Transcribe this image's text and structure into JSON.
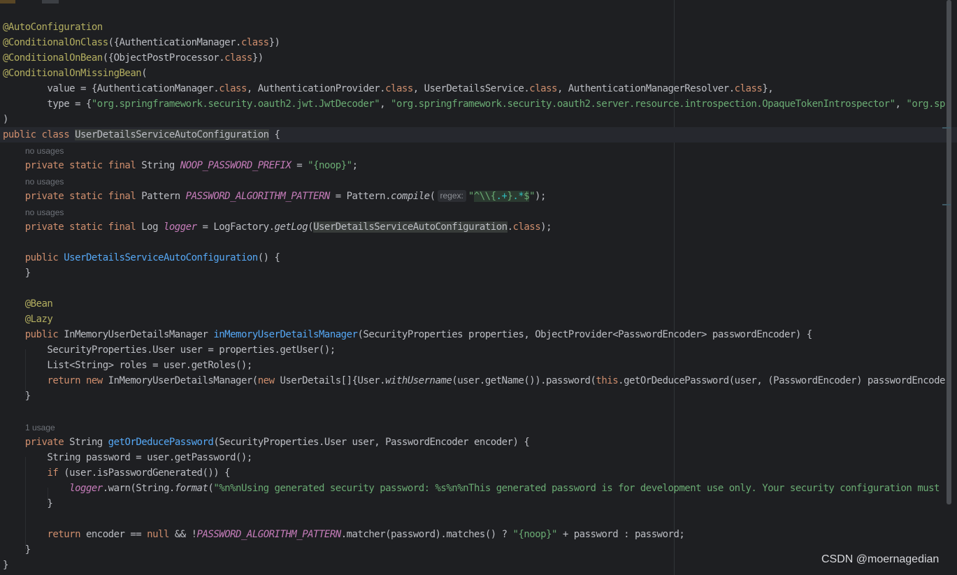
{
  "code_lines": [
    [
      {
        "t": "@AutoConfiguration",
        "c": "ann"
      }
    ],
    [
      {
        "t": "@ConditionalOnClass",
        "c": "ann"
      },
      {
        "t": "({AuthenticationManager."
      },
      {
        "t": "class",
        "c": "kw"
      },
      {
        "t": "})"
      }
    ],
    [
      {
        "t": "@ConditionalOnBean",
        "c": "ann"
      },
      {
        "t": "({ObjectPostProcessor."
      },
      {
        "t": "class",
        "c": "kw"
      },
      {
        "t": "})"
      }
    ],
    [
      {
        "t": "@ConditionalOnMissingBean",
        "c": "ann"
      },
      {
        "t": "("
      }
    ],
    [
      {
        "t": "        value = {AuthenticationManager."
      },
      {
        "t": "class",
        "c": "kw"
      },
      {
        "t": ", AuthenticationProvider."
      },
      {
        "t": "class",
        "c": "kw"
      },
      {
        "t": ", UserDetailsService."
      },
      {
        "t": "class",
        "c": "kw"
      },
      {
        "t": ", AuthenticationManagerResolver."
      },
      {
        "t": "class",
        "c": "kw"
      },
      {
        "t": "},"
      }
    ],
    [
      {
        "t": "        type = {"
      },
      {
        "t": "\"org.springframework.security.oauth2.jwt.JwtDecoder\"",
        "c": "str"
      },
      {
        "t": ", "
      },
      {
        "t": "\"org.springframework.security.oauth2.server.resource.introspection.OpaqueTokenIntrospector\"",
        "c": "str"
      },
      {
        "t": ", "
      },
      {
        "t": "\"org.sp",
        "c": "str"
      }
    ],
    [
      {
        "t": ")"
      }
    ],
    [
      {
        "t": "public class ",
        "c": "kw"
      },
      {
        "t": "UserDetailsServiceAutoConfiguration",
        "c": "hl"
      },
      {
        "t": " {"
      }
    ],
    [
      {
        "t": "    "
      },
      {
        "t": "private static final ",
        "c": "kw"
      },
      {
        "t": "String "
      },
      {
        "t": "NOOP_PASSWORD_PREFIX",
        "c": "cst"
      },
      {
        "t": " = "
      },
      {
        "t": "\"{noop}\"",
        "c": "str"
      },
      {
        "t": ";"
      }
    ],
    [
      {
        "t": "    "
      },
      {
        "t": "private static final ",
        "c": "kw"
      },
      {
        "t": "Pattern "
      },
      {
        "t": "PASSWORD_ALGORITHM_PATTERN",
        "c": "cst"
      },
      {
        "t": " = Pattern."
      },
      {
        "t": "compile",
        "c": "it"
      },
      {
        "t": "("
      },
      {
        "t": "regex:",
        "c": "inlay"
      },
      {
        "t": "\"",
        "c": "str"
      },
      {
        "t": "^\\\\{",
        "c": "rx"
      },
      {
        "t": ".+",
        "c": "rxm"
      },
      {
        "t": "}",
        "c": "rx"
      },
      {
        "t": ".*",
        "c": "rxm"
      },
      {
        "t": "$",
        "c": "rx"
      },
      {
        "t": "\"",
        "c": "str"
      },
      {
        "t": ");"
      }
    ],
    [
      {
        "t": "    "
      },
      {
        "t": "private static final ",
        "c": "kw"
      },
      {
        "t": "Log "
      },
      {
        "t": "logger",
        "c": "cst"
      },
      {
        "t": " = LogFactory."
      },
      {
        "t": "getLog",
        "c": "it"
      },
      {
        "t": "("
      },
      {
        "t": "UserDetailsServiceAutoConfiguration",
        "c": "hl"
      },
      {
        "t": "."
      },
      {
        "t": "class",
        "c": "kw"
      },
      {
        "t": ");"
      }
    ],
    [
      {
        "t": "    "
      },
      {
        "t": "public ",
        "c": "kw"
      },
      {
        "t": "UserDetailsServiceAutoConfiguration",
        "c": "fn"
      },
      {
        "t": "() {"
      }
    ],
    [
      {
        "t": "    }"
      }
    ],
    [
      {
        "t": "    "
      },
      {
        "t": "@Bean",
        "c": "ann"
      }
    ],
    [
      {
        "t": "    "
      },
      {
        "t": "@Lazy",
        "c": "ann"
      }
    ],
    [
      {
        "t": "    "
      },
      {
        "t": "public ",
        "c": "kw"
      },
      {
        "t": "InMemoryUserDetailsManager "
      },
      {
        "t": "inMemoryUserDetailsManager",
        "c": "fn"
      },
      {
        "t": "(SecurityProperties properties, ObjectProvider<PasswordEncoder> passwordEncoder) {"
      }
    ],
    [
      {
        "t": "        SecurityProperties.User user = properties.getUser();"
      }
    ],
    [
      {
        "t": "        List<String> roles = user.getRoles();"
      }
    ],
    [
      {
        "t": "        "
      },
      {
        "t": "return new ",
        "c": "kw"
      },
      {
        "t": "InMemoryUserDetailsManager("
      },
      {
        "t": "new ",
        "c": "kw"
      },
      {
        "t": "UserDetails[]{User."
      },
      {
        "t": "withUsername",
        "c": "it"
      },
      {
        "t": "(user.getName()).password("
      },
      {
        "t": "this",
        "c": "kw"
      },
      {
        "t": ".getOrDeducePassword(user, (PasswordEncoder) passwordEncode"
      }
    ],
    [
      {
        "t": "    }"
      }
    ],
    [
      {
        "t": "    "
      },
      {
        "t": "private ",
        "c": "kw"
      },
      {
        "t": "String "
      },
      {
        "t": "getOrDeducePassword",
        "c": "fn"
      },
      {
        "t": "(SecurityProperties.User user, PasswordEncoder encoder) {"
      }
    ],
    [
      {
        "t": "        String password = user.getPassword();"
      }
    ],
    [
      {
        "t": "        "
      },
      {
        "t": "if ",
        "c": "kw"
      },
      {
        "t": "(user.isPasswordGenerated()) {"
      }
    ],
    [
      {
        "t": "            "
      },
      {
        "t": "logger",
        "c": "cst"
      },
      {
        "t": ".warn(String."
      },
      {
        "t": "format",
        "c": "it"
      },
      {
        "t": "("
      },
      {
        "t": "\"%n%nUsing generated security password: %s%n%nThis generated password is for development use only. Your security configuration must",
        "c": "str"
      }
    ],
    [
      {
        "t": "        }"
      }
    ],
    [
      {
        "t": "        "
      },
      {
        "t": "return ",
        "c": "kw"
      },
      {
        "t": "encoder == "
      },
      {
        "t": "null",
        "c": "kw"
      },
      {
        "t": " && !"
      },
      {
        "t": "PASSWORD_ALGORITHM_PATTERN",
        "c": "cst"
      },
      {
        "t": ".matcher(password).matches() ? "
      },
      {
        "t": "\"{noop}\"",
        "c": "str"
      },
      {
        "t": " + password : password;"
      }
    ],
    [
      {
        "t": "    }"
      }
    ],
    [
      {
        "t": "}"
      }
    ]
  ],
  "usage_hints": [
    "no usages",
    "no usages",
    "no usages",
    "1 usage"
  ],
  "watermark": "CSDN @moernagedian",
  "colors": {
    "background": "#1e1f22",
    "keyword": "#cf8e6d",
    "annotation": "#b3ae60",
    "string": "#6aab73",
    "method": "#56a8f5",
    "constant": "#c77dbb",
    "plain": "#bcbec4",
    "hint": "#6f737a"
  }
}
